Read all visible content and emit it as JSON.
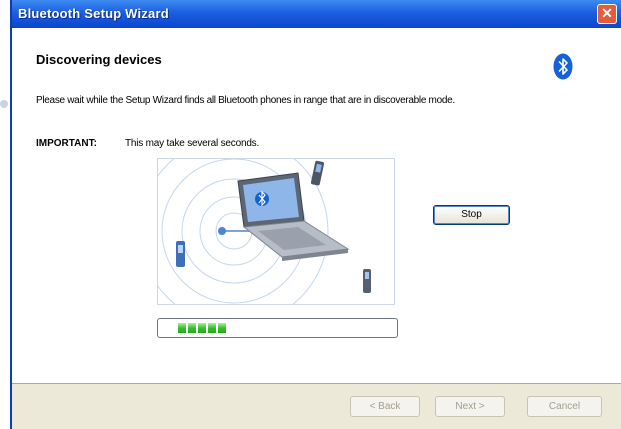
{
  "window": {
    "title": "Bluetooth Setup Wizard"
  },
  "header": {
    "title": "Discovering devices"
  },
  "content": {
    "description": "Please wait while the Setup Wizard finds all Bluetooth phones in range that are in discoverable mode.",
    "important_label": "IMPORTANT:",
    "important_text": "This may take several seconds.",
    "progress_segments_shown": 5
  },
  "buttons": {
    "stop": "Stop",
    "back": "< Back",
    "next": "Next >",
    "cancel": "Cancel"
  },
  "icons": {
    "close": "close-icon",
    "bluetooth": "bluetooth-icon",
    "laptop": "laptop-icon",
    "phone": "phone-icon"
  },
  "colors": {
    "title_bar": "#1c5fe0",
    "close_button": "#e35d3a",
    "progress_fill": "#34c12a",
    "bluetooth": "#1462d8"
  }
}
